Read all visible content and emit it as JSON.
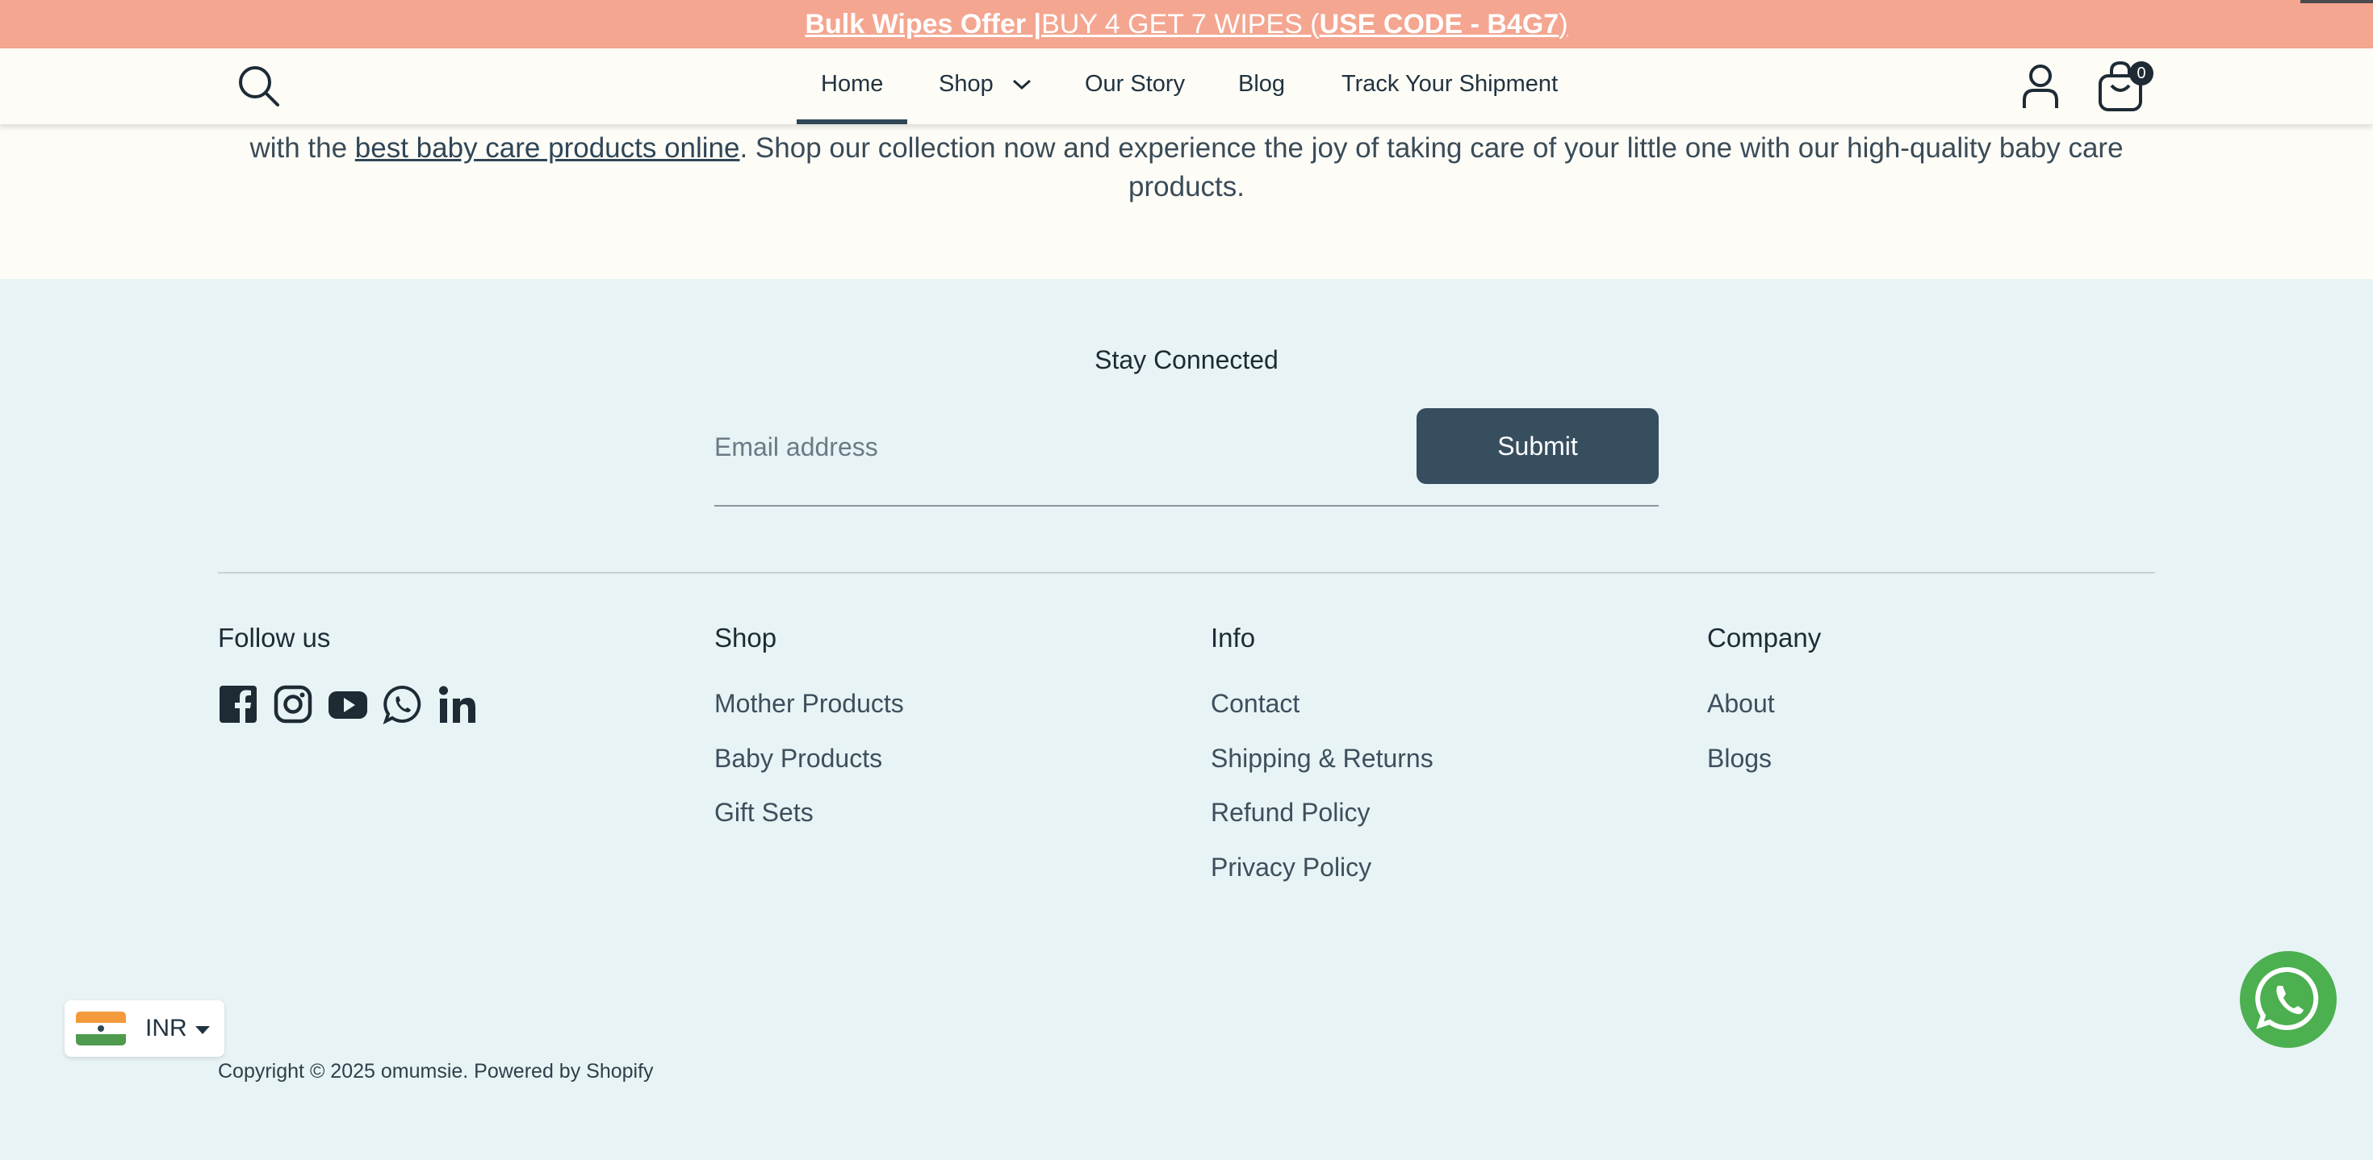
{
  "announcement": {
    "part1": "Bulk Wipes Offer |",
    "part2": " BUY 4 GET 7 WIPES (",
    "code": " USE CODE - B4G7",
    "part3": ")"
  },
  "header": {
    "nav": [
      {
        "label": "Home",
        "active": true
      },
      {
        "label": "Shop",
        "has_dropdown": true
      },
      {
        "label": "Our Story"
      },
      {
        "label": "Blog"
      },
      {
        "label": "Track Your Shipment"
      }
    ],
    "cart_count": "0",
    "icons": [
      "search-icon",
      "account-icon",
      "cart-icon",
      "chevron-down-icon"
    ]
  },
  "intro": {
    "line1_prefix": "with the ",
    "link": "best baby care products online",
    "line1_suffix": ". Shop our collection now and experience the joy of taking care of your little one with our high-quality baby care products."
  },
  "newsletter": {
    "title": "Stay Connected",
    "placeholder": "Email address",
    "submit_label": "Submit"
  },
  "footer": {
    "follow_title": "Follow us",
    "social_icons": [
      "facebook-icon",
      "instagram-icon",
      "youtube-icon",
      "whatsapp-icon",
      "linkedin-icon"
    ],
    "shop": {
      "title": "Shop",
      "links": [
        "Mother Products",
        "Baby Products",
        "Gift Sets"
      ]
    },
    "info": {
      "title": "Info",
      "links": [
        "Contact",
        "Shipping & Returns",
        "Refund Policy",
        "Privacy Policy"
      ]
    },
    "company": {
      "title": "Company",
      "links": [
        "About",
        "Blogs"
      ]
    },
    "copyright": "Copyright © 2025 omumsie. Powered by Shopify"
  },
  "currency": {
    "code": "INR",
    "flag": "india-flag"
  },
  "colors": {
    "announcement_bg": "#f4a690",
    "header_bg": "#fdfcf7",
    "footer_bg": "#e8f3f5",
    "submit_bg": "#374e5f",
    "whatsapp_green": "#4caf50"
  }
}
